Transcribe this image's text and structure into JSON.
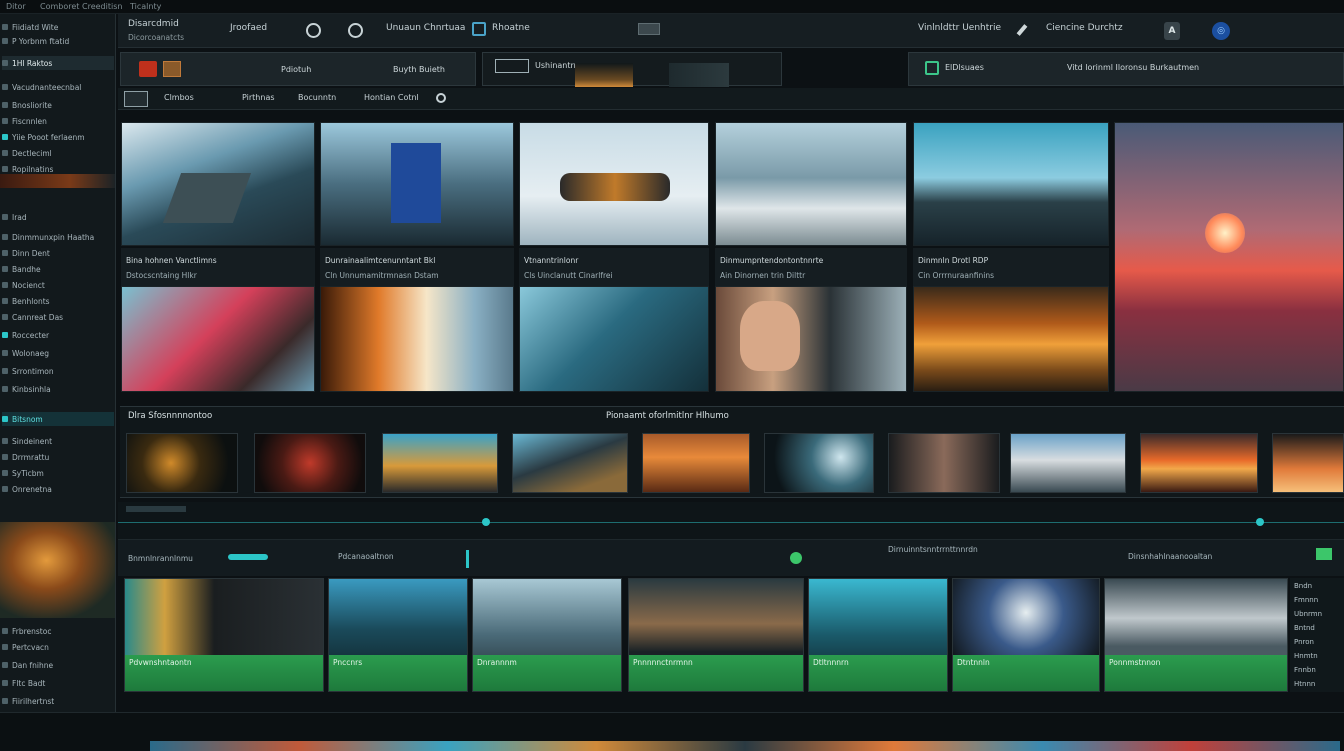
{
  "menu": {
    "items": [
      "Ditor",
      "Comboret",
      "Creeditisn",
      "Ticalnty"
    ]
  },
  "sidebar": {
    "items": [
      {
        "label": "Fiidiatd Wite"
      },
      {
        "label": "P Yorbnm ftatid"
      },
      {
        "label": "1Hl Raktos"
      },
      {
        "label": "Vacudnanteecnbal"
      },
      {
        "label": "Bnosliorite"
      },
      {
        "label": "Fiscnnlen"
      },
      {
        "label": "Yiie Pooot ferlaenm"
      },
      {
        "label": "Dectleciml"
      },
      {
        "label": "Ropilnatins"
      },
      {
        "label": "Irad"
      },
      {
        "label": "Dinmmunxpin Haatha"
      },
      {
        "label": "Dinn Dent"
      },
      {
        "label": "Bandhe"
      },
      {
        "label": "Nocienct"
      },
      {
        "label": "Benhlonts"
      },
      {
        "label": "Cannreat Das"
      },
      {
        "label": "Roccecter"
      },
      {
        "label": "Wolonaeg"
      },
      {
        "label": "Srrontimon"
      },
      {
        "label": "Kinbsinhla"
      },
      {
        "label": "Bitsnom"
      },
      {
        "label": "Sindeinent"
      },
      {
        "label": "Drrmrattu"
      },
      {
        "label": "SyTicbm"
      },
      {
        "label": "Onrenetna"
      },
      {
        "label": "Frbrenstoc"
      },
      {
        "label": "Pertcvacn"
      },
      {
        "label": "Dan fnihne"
      },
      {
        "label": "Fltc Badt"
      },
      {
        "label": "Fiirilhertnst"
      }
    ]
  },
  "header": {
    "left_title": "Disarcdmid",
    "left_sub": "Dicorcoanatcts",
    "project": "Jroofaed",
    "menu_label": "Unuaun Chnrtuaa",
    "breadcrumb": "Rhoatne",
    "right_label": "Vinlnldttr Uenhtrie",
    "right_label2": "Ciencine Durchtz",
    "btn_a": "A"
  },
  "panels": {
    "p1_label": "Pdiotuh",
    "p1_sub": "Buyth Buieth",
    "p2_label": "Ushinantrn",
    "p3_label": "ElDlsuaes",
    "p3_text": "Vitd lorinml Iloronsu Burkautmen"
  },
  "toolbar": {
    "items": [
      "Clmbos",
      "Pirthnas",
      "Bocunntn",
      "Hontian Cotnl"
    ]
  },
  "grid": {
    "captions": [
      {
        "l1": "Bina hohnen Vanctlimns",
        "l2": "Dstocscntaing  Hlkr"
      },
      {
        "l1": "Dunrainaalimtcenunntant  Bkl",
        "l2": "Cln  Unnumamitrmnasn  Dstam"
      },
      {
        "l1": "Vtnanntrinlonr",
        "l2": "Cls  Uinclanutt  Cinarlfrei"
      },
      {
        "l1": "Dinmumpntendontontnnrte",
        "l2": "Ain  Dinornen trin  Dilttr"
      },
      {
        "l1": "Dinmnln  Drotl RDP",
        "l2": "Cin  Orrrnuraanfinins"
      }
    ]
  },
  "section": {
    "left_title": "Dlra Sfosnnnnontoo",
    "center_title": "Pionaamt oforlmitlnr Hlhumo"
  },
  "timeline": {
    "marker": "Pdcanaoaltnon",
    "track_labels": [
      "Bnmnlnrannlnmu",
      "Dirnuinntsnntrrnttnnrdn",
      "Dinsnhahlnaanooaltan"
    ],
    "clip_labels": [
      "Pdvwnshntaontn",
      "Pnccnrs",
      "Dnrannnm",
      "Pnnnnnctnrmnn",
      "Dtltnnnrn",
      "Dtntnnln",
      "Ponnmstnnon"
    ],
    "right_list": [
      "Bndn",
      "Fmnnn",
      "Ubnrmn",
      "Bntnd",
      "Pnron",
      "Hnmtn",
      "Fnnbn",
      "Htnnn"
    ]
  },
  "colors": {
    "background": "#0c1114",
    "panel": "#1c2529",
    "accent_teal": "#2cc6c8",
    "clip_green": "#2b9c4e",
    "accent_blue": "#1b4fa0"
  }
}
